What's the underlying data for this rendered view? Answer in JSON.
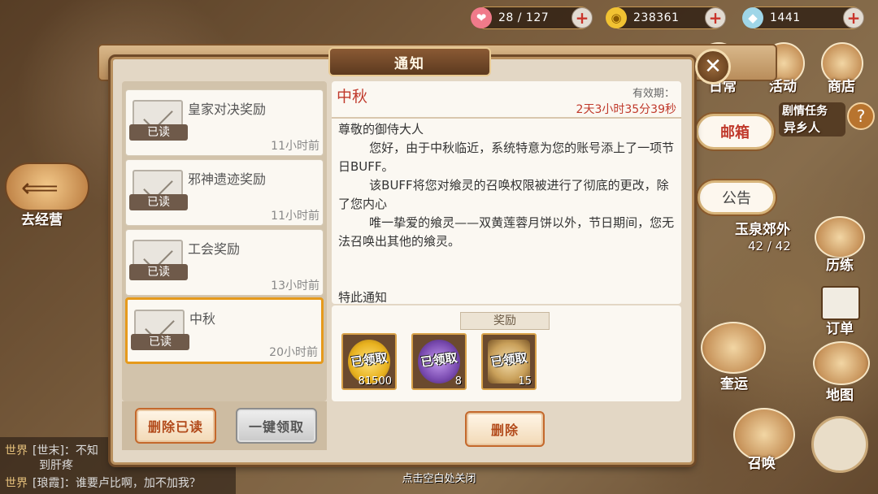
{
  "resources": [
    {
      "icon": "heart-icon",
      "value": "28 / 127"
    },
    {
      "icon": "coin-icon",
      "value": "238361"
    },
    {
      "icon": "crystal-icon",
      "value": "1441"
    }
  ],
  "hud": {
    "daily": "日常",
    "events": "活动",
    "shop": "商店",
    "story_task": "剧情任务",
    "story_sub": "异乡人",
    "help": "?",
    "mailbox": "邮箱",
    "notice": "公告",
    "back": "去经营",
    "area": "玉泉郊外",
    "area_progress": "42 / 42",
    "training": "历练",
    "orders": "订单",
    "fortune": "奎运",
    "map": "地图",
    "summon": "召唤"
  },
  "chat": {
    "lines": [
      {
        "tag": "世界",
        "text": "[世末]：不知",
        "cont": "到肝疼"
      },
      {
        "tag": "世界",
        "text": "[琅霞]：谁要卢比啊，加不加我？"
      }
    ]
  },
  "dialog": {
    "title": "通知",
    "close": "✕",
    "mails": [
      {
        "title": "皇家对决奖励",
        "status": "已读",
        "time": "11小时前"
      },
      {
        "title": "邪神遗迹奖励",
        "status": "已读",
        "time": "11小时前"
      },
      {
        "title": "工会奖励",
        "status": "已读",
        "time": "13小时前"
      },
      {
        "title": "中秋",
        "status": "已读",
        "time": "20小时前"
      }
    ],
    "delete_read": "删除已读",
    "claim_all": "一键领取",
    "detail": {
      "title": "中秋",
      "valid_label": "有效期：",
      "valid_time": "2天3小时35分39秒",
      "body": "尊敬的御侍大人\n        您好，由于中秋临近，系统特意为您的账号添上了一项节日BUFF。\n        该BUFF将您对飨灵的召唤权限被进行了彻底的更改，除了您内心\n        唯一挚爱的飨灵——双黄莲蓉月饼以外，节日期间，您无法召唤出其他的飨灵。\n\n\n特此通知",
      "reward_label": "奖励",
      "rewards": [
        {
          "name": "coin-reward",
          "claimed": "已领取",
          "qty": "81500",
          "color": "#e8b21f"
        },
        {
          "name": "purple-orb-reward",
          "claimed": "已领取",
          "qty": "8",
          "color": "#7a4bb0"
        },
        {
          "name": "tag-reward",
          "claimed": "已领取",
          "qty": "15",
          "color": "#c9a05a"
        }
      ],
      "delete": "删除"
    },
    "hint": "点击空白处关闭"
  }
}
